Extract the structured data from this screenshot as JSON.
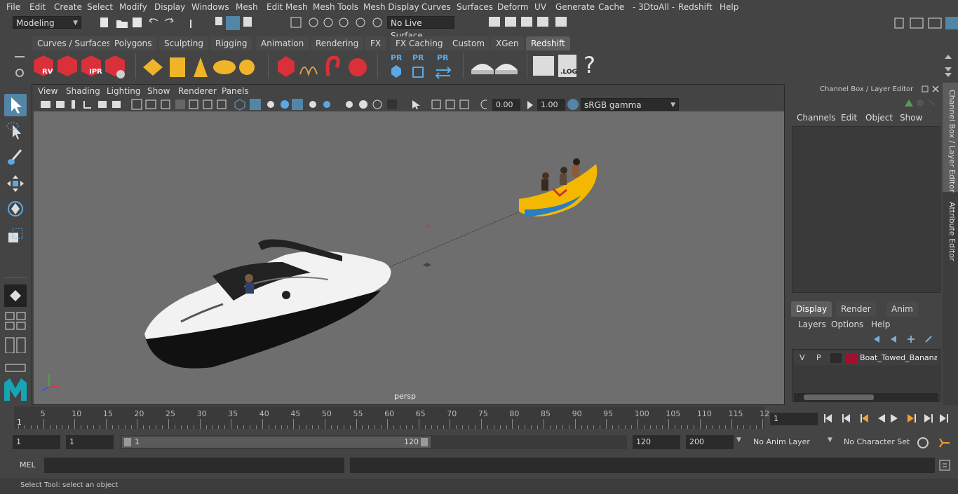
{
  "menubar": {
    "items": [
      "File",
      "Edit",
      "Create",
      "Select",
      "Modify",
      "Display",
      "Windows",
      "Mesh",
      "Edit Mesh",
      "Mesh Tools",
      "Mesh Display",
      "Curves",
      "Surfaces",
      "Deform",
      "UV",
      "Generate",
      "Cache",
      "- 3DtoAll -",
      "Redshift",
      "Help"
    ]
  },
  "statusline": {
    "mode": "Modeling",
    "live_surface": "No Live Surface"
  },
  "shelf": {
    "tabs": [
      "Curves / Surfaces",
      "Polygons",
      "Sculpting",
      "Rigging",
      "Animation",
      "Rendering",
      "FX",
      "FX Caching",
      "Custom",
      "XGen",
      "Redshift"
    ],
    "active_tab": "Redshift",
    "rv_label": "RV",
    "ipr_label": "IPR",
    "pr_label": "PR",
    "log_label": ".LOG",
    "help_glyph": "?"
  },
  "viewport": {
    "menu": [
      "View",
      "Shading",
      "Lighting",
      "Show",
      "Renderer",
      "Panels"
    ],
    "exposure": "0.00",
    "gamma": "1.00",
    "colorspace": "sRGB gamma",
    "camera_label": "persp"
  },
  "channel_box": {
    "title": "Channel Box / Layer Editor",
    "menu": [
      "Channels",
      "Edit",
      "Object",
      "Show"
    ]
  },
  "layer_editor": {
    "tabs": [
      "Display",
      "Render",
      "Anim"
    ],
    "active_tab": "Display",
    "menu": [
      "Layers",
      "Options",
      "Help"
    ],
    "layer": {
      "v": "V",
      "p": "P",
      "name": "Boat_Towed_Banana_B",
      "color": "#a3102f"
    }
  },
  "side_tabs": [
    "Channel Box / Layer Editor",
    "Attribute Editor"
  ],
  "time_slider": {
    "ticks": [
      "5",
      "10",
      "15",
      "20",
      "25",
      "30",
      "35",
      "40",
      "45",
      "50",
      "55",
      "60",
      "65",
      "70",
      "75",
      "80",
      "85",
      "90",
      "95",
      "100",
      "105",
      "110",
      "115",
      "12"
    ],
    "current_marker": "1",
    "current_frame": "1"
  },
  "range": {
    "start": "1",
    "playback_start": "1",
    "slider_start": "1",
    "slider_end": "120",
    "playback_end": "120",
    "end": "200",
    "anim_layer": "No Anim Layer",
    "character_set": "No Character Set"
  },
  "command": {
    "label": "MEL"
  },
  "help_line": {
    "text": "Select Tool: select an object"
  },
  "colors": {
    "accent": "#5285a6",
    "viewport_bg": "#6e6e6e",
    "redshift_red": "#d9303a"
  }
}
